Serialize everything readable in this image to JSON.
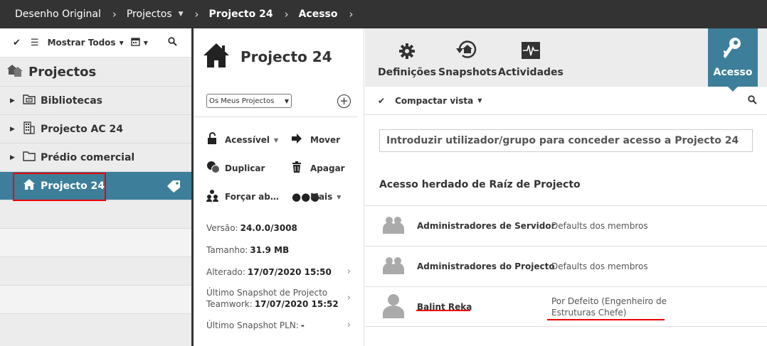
{
  "breadcrumb": {
    "items": [
      "Desenho Original",
      "Projectos",
      "Projecto 24",
      "Acesso"
    ]
  },
  "tree_panel": {
    "toolbar": {
      "filter_label": "Mostrar Todos"
    },
    "title": "Projectos",
    "items": [
      {
        "label": "Bibliotecas",
        "icon": "library-folder-icon"
      },
      {
        "label": "Projecto AC 24",
        "icon": "building-icon"
      },
      {
        "label": "Prédio comercial",
        "icon": "folder-icon"
      },
      {
        "label": "Projecto 24",
        "icon": "house-icon",
        "selected": true
      }
    ]
  },
  "details_panel": {
    "title": "Projecto 24",
    "select_value": "Os Meus Projectos",
    "actions": [
      {
        "label": "Acessível",
        "icon": "unlock-icon",
        "dropdown": true
      },
      {
        "label": "Mover",
        "icon": "arrow-right-icon"
      },
      {
        "label": "Duplicar",
        "icon": "duplicate-icon"
      },
      {
        "label": "Apagar",
        "icon": "trash-icon"
      },
      {
        "label": "Forçar ab…",
        "icon": "users-icon"
      },
      {
        "label": "Mais",
        "icon": "more-icon",
        "dropdown": true
      }
    ],
    "info": {
      "version_label": "Versão:",
      "version_value": "24.0.0/3008",
      "size_label": "Tamanho:",
      "size_value": "31.9 MB",
      "changed_label": "Alterado:",
      "changed_value": "17/07/2020 15:50",
      "snapshot_label_1": "Último Snapshot de Projecto",
      "snapshot_label_2": "Teamwork:",
      "snapshot_value": "17/07/2020 15:52",
      "pln_label": "Último Snapshot PLN:",
      "pln_value": "-"
    }
  },
  "access_panel": {
    "toolbar": {
      "settings_label": "Definições",
      "snapshots_label": "Snapshots",
      "activities_label": "Actividades",
      "access_label": "Acesso"
    },
    "compact_label": "Compactar vista",
    "input_placeholder": "Introduzir utilizador/grupo para conceder acesso a Projecto 24",
    "section_title": "Acesso herdado de Raíz de Projecto",
    "rows": [
      {
        "name": "Administradores de Servidor",
        "role": "Defaults dos membros",
        "icon": "group-icon"
      },
      {
        "name": "Administradores do Projecto",
        "role": "Defaults dos membros",
        "icon": "group-icon"
      },
      {
        "name": "Balint Reka",
        "role_line1": "Por Defeito  (Engenheiro de",
        "role_line2": "Estruturas Chefe)",
        "icon": "user-icon"
      }
    ]
  },
  "colors": {
    "topbar": "#333333",
    "accent": "#3d7f9a",
    "highlight": "#e00000"
  }
}
